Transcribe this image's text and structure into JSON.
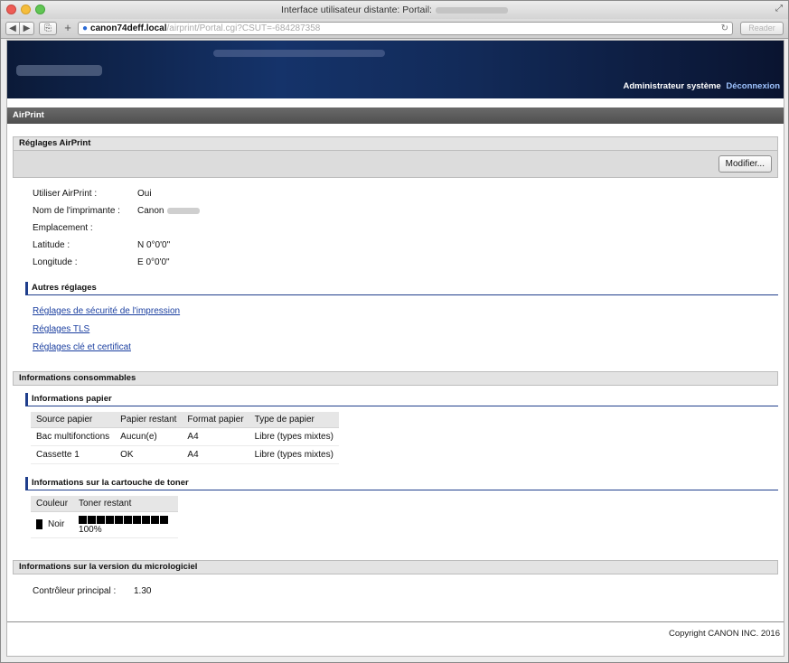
{
  "window": {
    "title": "Interface utilisateur distante: Portail:",
    "url_host": "canon74deff.local",
    "url_path": "/airprint/Portal.cgi?CSUT=-684287358",
    "reader_label": "Reader"
  },
  "header": {
    "user_label": "Administrateur système",
    "logout_label": "Déconnexion"
  },
  "page_title": "AirPrint",
  "airprint_settings": {
    "heading": "Réglages AirPrint",
    "modify_label": "Modifier...",
    "rows": [
      {
        "label": "Utiliser AirPrint :",
        "value": "Oui"
      },
      {
        "label": "Nom de l'imprimante :",
        "value": "Canon"
      },
      {
        "label": "Emplacement :",
        "value": ""
      },
      {
        "label": "Latitude :",
        "value": "N 0°0'0\""
      },
      {
        "label": "Longitude :",
        "value": "E 0°0'0\""
      }
    ]
  },
  "other_settings": {
    "heading": "Autres réglages",
    "links": [
      "Réglages de sécurité de l'impression",
      "Réglages TLS",
      "Réglages clé et certificat"
    ]
  },
  "consumables": {
    "heading": "Informations consommables",
    "paper": {
      "heading": "Informations papier",
      "columns": [
        "Source papier",
        "Papier restant",
        "Format papier",
        "Type de papier"
      ],
      "rows": [
        [
          "Bac multifonctions",
          "Aucun(e)",
          "A4",
          "Libre (types mixtes)"
        ],
        [
          "Cassette 1",
          "OK",
          "A4",
          "Libre (types mixtes)"
        ]
      ]
    },
    "toner": {
      "heading": "Informations sur la cartouche de toner",
      "columns": [
        "Couleur",
        "Toner restant"
      ],
      "rows": [
        {
          "color": "Noir",
          "level_percent": 100,
          "level_label": "100%",
          "swatch": "#000000"
        }
      ]
    }
  },
  "firmware": {
    "heading": "Informations sur la version du micrologiciel",
    "label": "Contrôleur principal :",
    "value": "1.30"
  },
  "footer": {
    "copyright": "Copyright CANON INC. 2016"
  }
}
